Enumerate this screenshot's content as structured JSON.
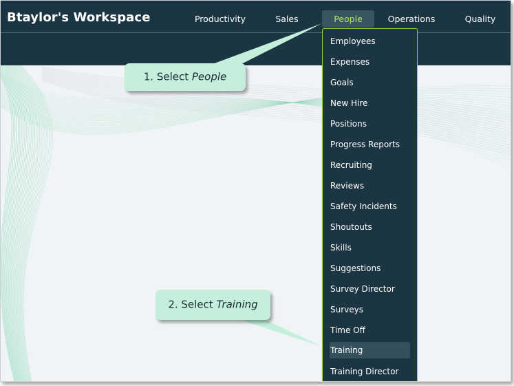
{
  "workspace": {
    "title": "Btaylor's Workspace"
  },
  "nav": {
    "items": [
      {
        "label": "Productivity"
      },
      {
        "label": "Sales"
      },
      {
        "label": "People",
        "active": true
      },
      {
        "label": "Operations"
      },
      {
        "label": "Quality"
      }
    ]
  },
  "people_menu": {
    "items": [
      {
        "label": "Employees"
      },
      {
        "label": "Expenses"
      },
      {
        "label": "Goals"
      },
      {
        "label": "New Hire"
      },
      {
        "label": "Positions"
      },
      {
        "label": "Progress Reports"
      },
      {
        "label": "Recruiting"
      },
      {
        "label": "Reviews"
      },
      {
        "label": "Safety Incidents"
      },
      {
        "label": "Shoutouts"
      },
      {
        "label": "Skills"
      },
      {
        "label": "Suggestions"
      },
      {
        "label": "Survey Director"
      },
      {
        "label": "Surveys"
      },
      {
        "label": "Time Off"
      },
      {
        "label": "Training",
        "highlighted": true
      },
      {
        "label": "Training Director"
      }
    ]
  },
  "callouts": {
    "step1": {
      "prefix": "1. Select ",
      "target": "People"
    },
    "step2": {
      "prefix": "2. Select ",
      "target": "Training"
    }
  },
  "colors": {
    "header_bg": "#1c3542",
    "active_nav_text": "#b5e85a",
    "menu_border": "#8fd23f",
    "callout_bg": "#c4efdc",
    "content_bg": "#f1f4f6",
    "wave_line": "#7fd6b2"
  }
}
